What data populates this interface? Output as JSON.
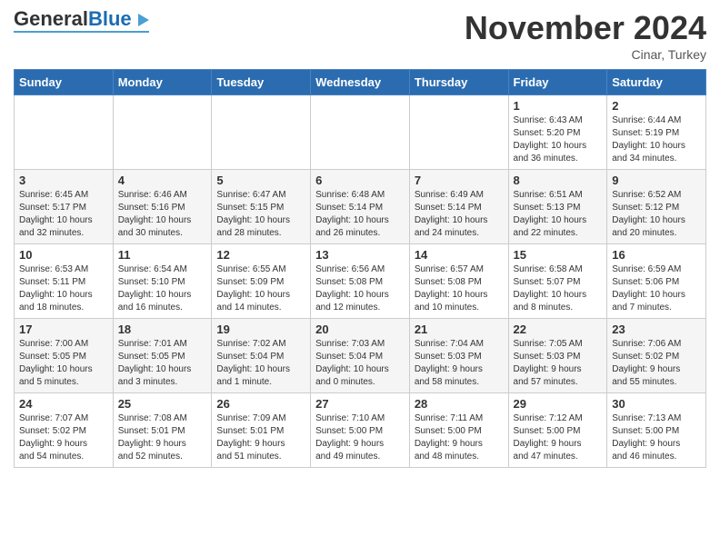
{
  "header": {
    "logo_general": "General",
    "logo_blue": "Blue",
    "title": "November 2024",
    "subtitle": "Cinar, Turkey"
  },
  "days_of_week": [
    "Sunday",
    "Monday",
    "Tuesday",
    "Wednesday",
    "Thursday",
    "Friday",
    "Saturday"
  ],
  "weeks": [
    {
      "days": [
        {
          "num": "",
          "info": ""
        },
        {
          "num": "",
          "info": ""
        },
        {
          "num": "",
          "info": ""
        },
        {
          "num": "",
          "info": ""
        },
        {
          "num": "",
          "info": ""
        },
        {
          "num": "1",
          "info": "Sunrise: 6:43 AM\nSunset: 5:20 PM\nDaylight: 10 hours\nand 36 minutes."
        },
        {
          "num": "2",
          "info": "Sunrise: 6:44 AM\nSunset: 5:19 PM\nDaylight: 10 hours\nand 34 minutes."
        }
      ]
    },
    {
      "days": [
        {
          "num": "3",
          "info": "Sunrise: 6:45 AM\nSunset: 5:17 PM\nDaylight: 10 hours\nand 32 minutes."
        },
        {
          "num": "4",
          "info": "Sunrise: 6:46 AM\nSunset: 5:16 PM\nDaylight: 10 hours\nand 30 minutes."
        },
        {
          "num": "5",
          "info": "Sunrise: 6:47 AM\nSunset: 5:15 PM\nDaylight: 10 hours\nand 28 minutes."
        },
        {
          "num": "6",
          "info": "Sunrise: 6:48 AM\nSunset: 5:14 PM\nDaylight: 10 hours\nand 26 minutes."
        },
        {
          "num": "7",
          "info": "Sunrise: 6:49 AM\nSunset: 5:14 PM\nDaylight: 10 hours\nand 24 minutes."
        },
        {
          "num": "8",
          "info": "Sunrise: 6:51 AM\nSunset: 5:13 PM\nDaylight: 10 hours\nand 22 minutes."
        },
        {
          "num": "9",
          "info": "Sunrise: 6:52 AM\nSunset: 5:12 PM\nDaylight: 10 hours\nand 20 minutes."
        }
      ]
    },
    {
      "days": [
        {
          "num": "10",
          "info": "Sunrise: 6:53 AM\nSunset: 5:11 PM\nDaylight: 10 hours\nand 18 minutes."
        },
        {
          "num": "11",
          "info": "Sunrise: 6:54 AM\nSunset: 5:10 PM\nDaylight: 10 hours\nand 16 minutes."
        },
        {
          "num": "12",
          "info": "Sunrise: 6:55 AM\nSunset: 5:09 PM\nDaylight: 10 hours\nand 14 minutes."
        },
        {
          "num": "13",
          "info": "Sunrise: 6:56 AM\nSunset: 5:08 PM\nDaylight: 10 hours\nand 12 minutes."
        },
        {
          "num": "14",
          "info": "Sunrise: 6:57 AM\nSunset: 5:08 PM\nDaylight: 10 hours\nand 10 minutes."
        },
        {
          "num": "15",
          "info": "Sunrise: 6:58 AM\nSunset: 5:07 PM\nDaylight: 10 hours\nand 8 minutes."
        },
        {
          "num": "16",
          "info": "Sunrise: 6:59 AM\nSunset: 5:06 PM\nDaylight: 10 hours\nand 7 minutes."
        }
      ]
    },
    {
      "days": [
        {
          "num": "17",
          "info": "Sunrise: 7:00 AM\nSunset: 5:05 PM\nDaylight: 10 hours\nand 5 minutes."
        },
        {
          "num": "18",
          "info": "Sunrise: 7:01 AM\nSunset: 5:05 PM\nDaylight: 10 hours\nand 3 minutes."
        },
        {
          "num": "19",
          "info": "Sunrise: 7:02 AM\nSunset: 5:04 PM\nDaylight: 10 hours\nand 1 minute."
        },
        {
          "num": "20",
          "info": "Sunrise: 7:03 AM\nSunset: 5:04 PM\nDaylight: 10 hours\nand 0 minutes."
        },
        {
          "num": "21",
          "info": "Sunrise: 7:04 AM\nSunset: 5:03 PM\nDaylight: 9 hours\nand 58 minutes."
        },
        {
          "num": "22",
          "info": "Sunrise: 7:05 AM\nSunset: 5:03 PM\nDaylight: 9 hours\nand 57 minutes."
        },
        {
          "num": "23",
          "info": "Sunrise: 7:06 AM\nSunset: 5:02 PM\nDaylight: 9 hours\nand 55 minutes."
        }
      ]
    },
    {
      "days": [
        {
          "num": "24",
          "info": "Sunrise: 7:07 AM\nSunset: 5:02 PM\nDaylight: 9 hours\nand 54 minutes."
        },
        {
          "num": "25",
          "info": "Sunrise: 7:08 AM\nSunset: 5:01 PM\nDaylight: 9 hours\nand 52 minutes."
        },
        {
          "num": "26",
          "info": "Sunrise: 7:09 AM\nSunset: 5:01 PM\nDaylight: 9 hours\nand 51 minutes."
        },
        {
          "num": "27",
          "info": "Sunrise: 7:10 AM\nSunset: 5:00 PM\nDaylight: 9 hours\nand 49 minutes."
        },
        {
          "num": "28",
          "info": "Sunrise: 7:11 AM\nSunset: 5:00 PM\nDaylight: 9 hours\nand 48 minutes."
        },
        {
          "num": "29",
          "info": "Sunrise: 7:12 AM\nSunset: 5:00 PM\nDaylight: 9 hours\nand 47 minutes."
        },
        {
          "num": "30",
          "info": "Sunrise: 7:13 AM\nSunset: 5:00 PM\nDaylight: 9 hours\nand 46 minutes."
        }
      ]
    }
  ]
}
